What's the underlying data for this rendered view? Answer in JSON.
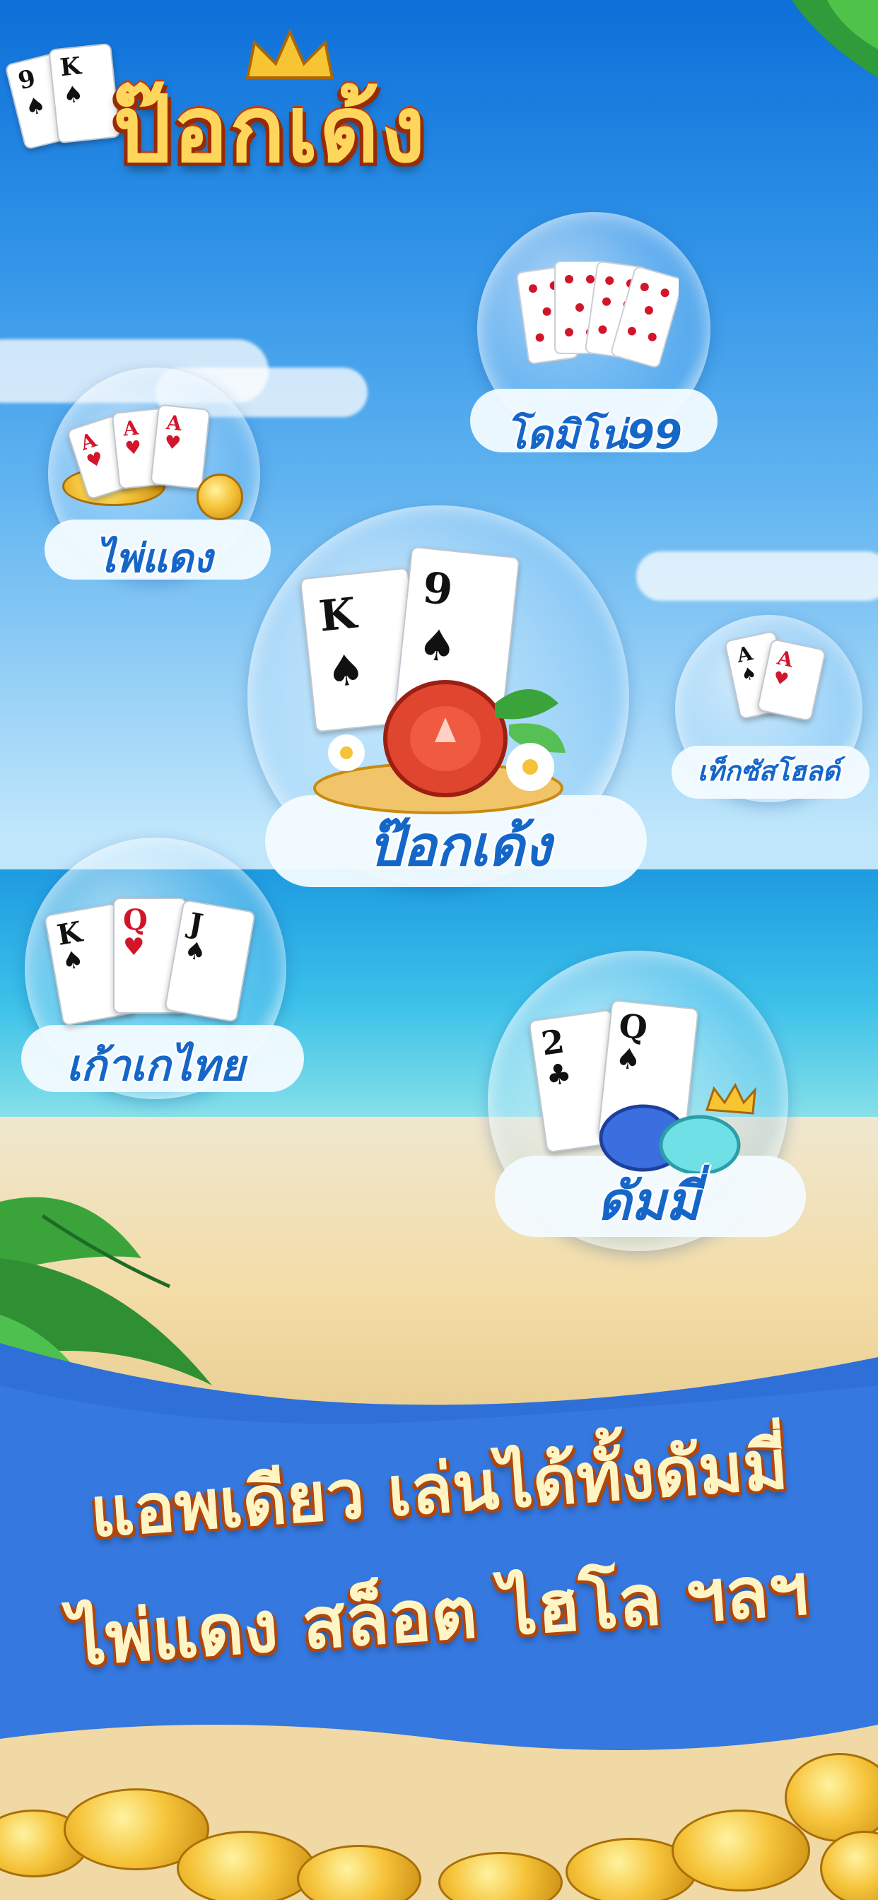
{
  "app": {
    "logo_title": "ป๊อกเด้ง"
  },
  "games": [
    {
      "label": "โดมิโน่99",
      "icon": "domino-cards-icon"
    },
    {
      "label": "ไพ่แดง",
      "icon": "aces-chips-icon"
    },
    {
      "label": "ป๊อกเด้ง",
      "icon": "king-nine-chip-icon"
    },
    {
      "label": "เท็กซัสโฮลด์",
      "icon": "two-aces-icon"
    },
    {
      "label": "เก้าเกไทย",
      "icon": "kqj-cards-icon"
    },
    {
      "label": "ดัมมี่",
      "icon": "two-queen-crown-icon"
    }
  ],
  "cards": {
    "logo": [
      "9",
      "K"
    ],
    "pokdeng": [
      "K",
      "9"
    ],
    "kaokae": [
      "K",
      "Q",
      "J"
    ],
    "dummy": [
      "2",
      "Q"
    ],
    "paideng": [
      "A",
      "A",
      "A"
    ],
    "texas": [
      "A",
      "A"
    ]
  },
  "slogan": {
    "line1": "แอพเดียว เล่นได้ทั้งดัมมี่",
    "line2": "ไพ่แดง สล็อต ไฮโล ฯลฯ"
  },
  "colors": {
    "sky": "#2b8fe6",
    "banner": "#2f6fd8",
    "label_blue": "#1566c9",
    "slogan_text": "#fff5c4",
    "slogan_outline": "#b0460c"
  }
}
